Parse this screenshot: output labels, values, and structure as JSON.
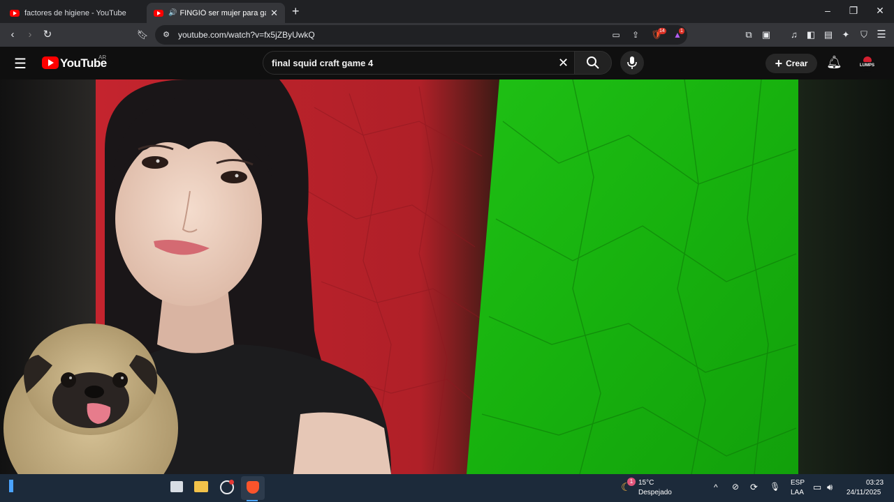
{
  "tabs": [
    {
      "title": "factores de higiene - YouTube",
      "active": false
    },
    {
      "title": "FINGIÓ ser mujer para ganar",
      "active": true
    }
  ],
  "toolbar": {
    "url": "youtube.com/watch?v=fx5jZByUwkQ",
    "brave_shields_count": "14",
    "rewards_count": "1"
  },
  "youtube": {
    "logo_text": "YouTube",
    "country_code": "AR",
    "search_value": "final squid craft game 4",
    "create_label": "Crear",
    "avatar_text": "LUMPS"
  },
  "taskbar": {
    "weather_temp": "15°C",
    "weather_desc": "Despejado",
    "weather_badge": "1",
    "lang_top": "ESP",
    "lang_bottom": "LAA",
    "time": "03:23",
    "date": "24/11/2025"
  },
  "colors": {
    "yt_red": "#ff0000",
    "video_red": "#b8202a",
    "video_green": "#19b80f"
  }
}
